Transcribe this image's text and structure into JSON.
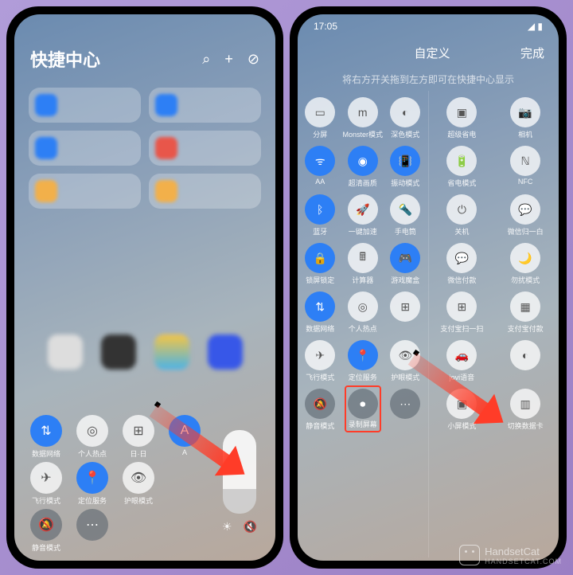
{
  "watermark": {
    "name": "HandsetCat",
    "url": "HANDSETCAT.COM"
  },
  "phone_left": {
    "title": "快捷中心",
    "status_time": "",
    "toggles": [
      {
        "id": "data",
        "label": "数据网络",
        "style": "tg-blue",
        "glyph": "⇅"
      },
      {
        "id": "hotspot",
        "label": "个人热点",
        "style": "tg-white",
        "glyph": "◎"
      },
      {
        "id": "a3",
        "label": "日·日",
        "style": "tg-white",
        "glyph": "⊞"
      },
      {
        "id": "a4",
        "label": "A",
        "style": "tg-blue",
        "glyph": "A"
      },
      {
        "id": "airplane",
        "label": "飞行模式",
        "style": "tg-white",
        "glyph": "✈"
      },
      {
        "id": "location",
        "label": "定位服务",
        "style": "tg-blue",
        "glyph": "📍"
      },
      {
        "id": "eye",
        "label": "护眼模式",
        "style": "tg-white",
        "glyph": "👁"
      },
      {
        "id": "sp1",
        "label": "",
        "style": "hidden",
        "glyph": ""
      },
      {
        "id": "mute",
        "label": "静音模式",
        "style": "tg-dark",
        "glyph": "🔕"
      },
      {
        "id": "more",
        "label": "",
        "style": "tg-dark",
        "glyph": "⋯"
      }
    ],
    "bright_icon": "☀",
    "mute_icon": "🔇"
  },
  "phone_right": {
    "status_time": "17:05",
    "header_center": "自定义",
    "header_done": "完成",
    "hint": "将右方开关拖到左方即可在快捷中心显示",
    "left_panel": [
      {
        "label": "分屏",
        "style": "tg-white",
        "glyph": "▭"
      },
      {
        "label": "Monster模式",
        "style": "tg-white",
        "glyph": "m"
      },
      {
        "label": "深色模式",
        "style": "tg-white",
        "glyph": "◐"
      },
      {
        "label": "AA",
        "style": "tg-blue",
        "glyph": "ᯤ"
      },
      {
        "label": "超清画质",
        "style": "tg-blue",
        "glyph": "◉"
      },
      {
        "label": "振动模式",
        "style": "tg-blue",
        "glyph": "📳"
      },
      {
        "label": "蓝牙",
        "style": "tg-blue",
        "glyph": "ᛒ"
      },
      {
        "label": "一键加速",
        "style": "tg-white",
        "glyph": "🚀"
      },
      {
        "label": "手电筒",
        "style": "tg-white",
        "glyph": "🔦"
      },
      {
        "label": "锁屏锁定",
        "style": "tg-blue",
        "glyph": "🔒"
      },
      {
        "label": "计算器",
        "style": "tg-white",
        "glyph": "🖩"
      },
      {
        "label": "游戏魔盒",
        "style": "tg-blue",
        "glyph": "🎮"
      },
      {
        "label": "数据网络",
        "style": "tg-blue",
        "glyph": "⇅"
      },
      {
        "label": "个人热点",
        "style": "tg-white",
        "glyph": "◎"
      },
      {
        "label": "",
        "style": "tg-white",
        "glyph": "⊞"
      },
      {
        "label": "飞行模式",
        "style": "tg-white",
        "glyph": "✈"
      },
      {
        "label": "定位服务",
        "style": "tg-blue",
        "glyph": "📍"
      },
      {
        "label": "护眼模式",
        "style": "tg-white",
        "glyph": "👁"
      },
      {
        "label": "静音模式",
        "style": "tg-dark",
        "glyph": "🔕"
      },
      {
        "label": "录制屏幕",
        "style": "tg-dark",
        "glyph": "⏺",
        "highlight": true
      },
      {
        "label": "",
        "style": "tg-dark",
        "glyph": "⋯"
      }
    ],
    "right_panel": [
      {
        "label": "超级省电",
        "style": "tg-white",
        "glyph": "▣"
      },
      {
        "label": "相机",
        "style": "tg-white",
        "glyph": "📷"
      },
      {
        "label": "省电模式",
        "style": "tg-white",
        "glyph": "🔋"
      },
      {
        "label": "NFC",
        "style": "tg-white",
        "glyph": "ℕ"
      },
      {
        "label": "关机",
        "style": "tg-white",
        "glyph": "⏻"
      },
      {
        "label": "微信归一白",
        "style": "tg-white",
        "glyph": "💬"
      },
      {
        "label": "微信付款",
        "style": "tg-white",
        "glyph": "💬"
      },
      {
        "label": "勿扰模式",
        "style": "tg-white",
        "glyph": "🌙"
      },
      {
        "label": "支付宝扫一扫",
        "style": "tg-white",
        "glyph": "⊞"
      },
      {
        "label": "支付宝付款",
        "style": "tg-white",
        "glyph": "▦"
      },
      {
        "label": "jovi语音",
        "style": "tg-white",
        "glyph": "🚗"
      },
      {
        "label": "",
        "style": "tg-white",
        "glyph": "◐"
      },
      {
        "label": "小屏模式",
        "style": "tg-white",
        "glyph": "▣"
      },
      {
        "label": "切换数据卡",
        "style": "tg-white",
        "glyph": "▥"
      }
    ]
  }
}
